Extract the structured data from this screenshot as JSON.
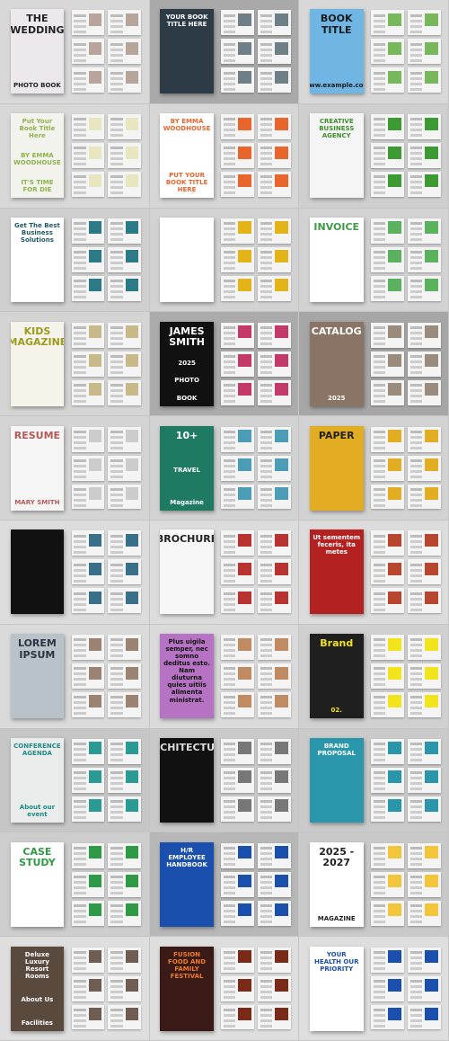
{
  "templates": [
    {
      "bg": "#d8d8d8",
      "cover": "#ece8ec",
      "fg": "#222",
      "accent": "#b8a59a",
      "lines": [
        "THE WEDDING",
        "PHOTO BOOK"
      ]
    },
    {
      "bg": "#a9a9a9",
      "cover": "#2d3b46",
      "fg": "#ffffff",
      "accent": "#6f7f88",
      "lines": [
        "YOUR BOOK TITLE HERE"
      ]
    },
    {
      "bg": "#d8d8d8",
      "cover": "#6fb6e4",
      "fg": "#1b1b1b",
      "accent": "#77b85a",
      "lines": [
        "BOOK TITLE",
        "www.example.com"
      ]
    },
    {
      "bg": "#d8d8d8",
      "cover": "#f3f3ee",
      "fg": "#8fb34a",
      "accent": "#e7e6bf",
      "lines": [
        "Put Your Book Title Here",
        "BY EMMA WOODHOUSE",
        "IT'S TIME FOR DIE"
      ]
    },
    {
      "bg": "#d6d6d6",
      "cover": "#ffffff",
      "fg": "#e8652b",
      "accent": "#e8652b",
      "lines": [
        "BY EMMA WOODHOUSE",
        "PUT YOUR BOOK TITLE HERE"
      ]
    },
    {
      "bg": "#cfcfcf",
      "cover": "#f5f5f5",
      "fg": "#3d8f2a",
      "accent": "#3d9a32",
      "lines": [
        "CREATIVE BUSINESS AGENCY"
      ]
    },
    {
      "bg": "#cfcfcf",
      "cover": "#ffffff",
      "fg": "#1d5a66",
      "accent": "#2c7a88",
      "lines": [
        "Get The Best Business Solutions"
      ]
    },
    {
      "bg": "#d2d2d2",
      "cover": "#ffffff",
      "fg": "#333",
      "accent": "#e3b417",
      "lines": []
    },
    {
      "bg": "#d2d2d2",
      "cover": "#ffffff",
      "fg": "#3f9b45",
      "accent": "#5cb15e",
      "lines": [
        "INVOICE"
      ]
    },
    {
      "bg": "#d4d4d4",
      "cover": "#f6f4ea",
      "fg": "#9b9b1e",
      "accent": "#c7b98a",
      "lines": [
        "KIDS MAGAZINE"
      ]
    },
    {
      "bg": "#ababab",
      "cover": "#111111",
      "fg": "#ffffff",
      "accent": "#c33a6a",
      "lines": [
        "JAMES SMITH",
        "2025",
        "PHOTO",
        "BOOK"
      ]
    },
    {
      "bg": "#a6a6a6",
      "cover": "#8a7466",
      "fg": "#ffffff",
      "accent": "#9a8c7c",
      "lines": [
        "CATALOG",
        "2025"
      ]
    },
    {
      "bg": "#d4d4d4",
      "cover": "#f5f5f5",
      "fg": "#b45a5a",
      "accent": "#cccccc",
      "lines": [
        "RESUME",
        "MARY SMITH"
      ]
    },
    {
      "bg": "#d2d2d2",
      "cover": "#1f7a63",
      "fg": "#ffffff",
      "accent": "#4b9cb5",
      "lines": [
        "10+",
        "TRAVEL",
        "Magazine"
      ]
    },
    {
      "bg": "#d2d2d2",
      "cover": "#e3ad23",
      "fg": "#222",
      "accent": "#e3ad23",
      "lines": [
        "PAPER"
      ]
    },
    {
      "bg": "#dcdcdc",
      "cover": "#111111",
      "fg": "#e89ab8",
      "accent": "#3a6f8a",
      "lines": []
    },
    {
      "bg": "#dcdcdc",
      "cover": "#f7f7f7",
      "fg": "#222",
      "accent": "#b8322f",
      "lines": [
        "BROCHURE"
      ]
    },
    {
      "bg": "#dcdcdc",
      "cover": "#b32120",
      "fg": "#ffffff",
      "accent": "#b8462f",
      "lines": [
        "Ut sementem feceris, ita metes"
      ]
    },
    {
      "bg": "#dadada",
      "cover": "#b9c1c9",
      "fg": "#2c3440",
      "accent": "#9a8373",
      "lines": [
        "LOREM IPSUM"
      ]
    },
    {
      "bg": "#dadada",
      "cover": "#b673c3",
      "fg": "#111111",
      "accent": "#c08a62",
      "lines": [
        "Plus uigila semper, nec somno deditus esto. Nam diuturna quies uitiis alimenta ministrat."
      ]
    },
    {
      "bg": "#d0d0d0",
      "cover": "#1f1f1f",
      "fg": "#f1e31c",
      "accent": "#f1e31c",
      "lines": [
        "Brand",
        "02."
      ]
    },
    {
      "bg": "#c6c6c6",
      "cover": "#eaeceb",
      "fg": "#1d8a86",
      "accent": "#2b9a93",
      "lines": [
        "CONFERENCE AGENDA",
        "About our event"
      ]
    },
    {
      "bg": "#c9c9c9",
      "cover": "#111111",
      "fg": "#dddddd",
      "accent": "#777777",
      "lines": [
        "ARCHITECTURE"
      ]
    },
    {
      "bg": "#cacaca",
      "cover": "#2a96ab",
      "fg": "#ffffff",
      "accent": "#2a96ab",
      "lines": [
        "BRAND PROPOSAL"
      ]
    },
    {
      "bg": "#cdcdcd",
      "cover": "#ffffff",
      "fg": "#2e9a46",
      "accent": "#2e9a46",
      "lines": [
        "CASE STUDY"
      ]
    },
    {
      "bg": "#b7b7b7",
      "cover": "#1b4fae",
      "fg": "#ffffff",
      "accent": "#1b4fae",
      "lines": [
        "H/R EMPLOYEE HANDBOOK"
      ]
    },
    {
      "bg": "#c9c9c9",
      "cover": "#ffffff",
      "fg": "#222",
      "accent": "#f2c53a",
      "lines": [
        "2025 - 2027",
        "MAGAZINE"
      ]
    },
    {
      "bg": "#dedede",
      "cover": "#5a4a3e",
      "fg": "#ffffff",
      "accent": "#6e5d50",
      "lines": [
        "Deluxe Luxury Resort Rooms",
        "About Us",
        "Facilities"
      ]
    },
    {
      "bg": "#dedede",
      "cover": "#3a1a16",
      "fg": "#f07c2a",
      "accent": "#7a2a16",
      "lines": [
        "FUSION FOOD AND FAMILY FESTIVAL"
      ]
    },
    {
      "bg": "#dedede",
      "cover": "#ffffff",
      "fg": "#1b4fae",
      "accent": "#1b4fae",
      "lines": [
        "YOUR HEALTH OUR PRIORITY"
      ]
    }
  ]
}
